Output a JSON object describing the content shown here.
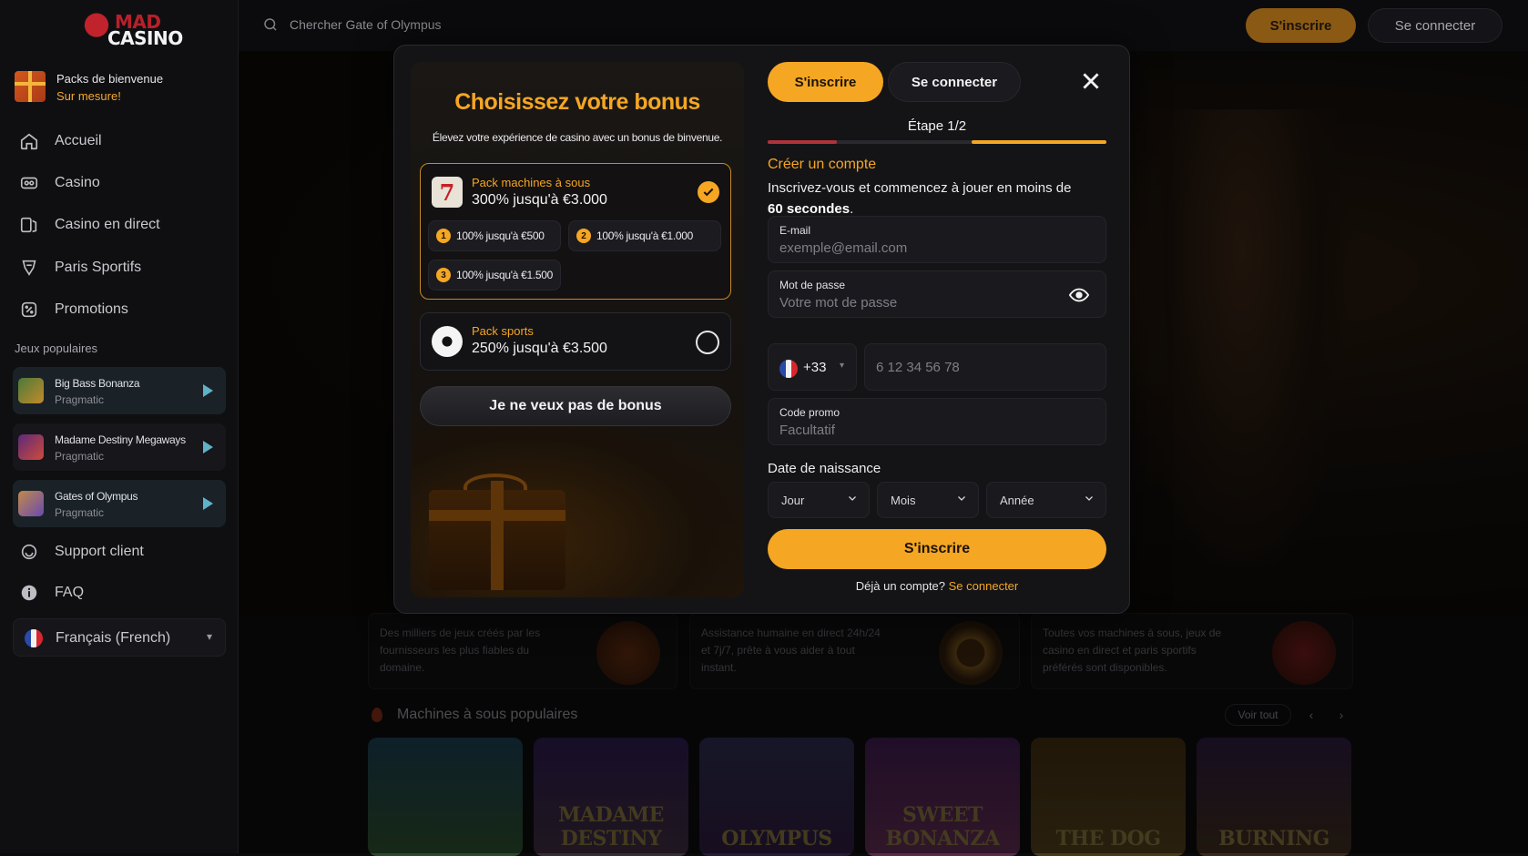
{
  "brand": {
    "mad": "MAD",
    "casino": "CASINO"
  },
  "welcome": {
    "title": "Packs de bienvenue",
    "subtitle": "Sur mesure!"
  },
  "nav": [
    {
      "label": "Accueil",
      "icon": "home-icon"
    },
    {
      "label": "Casino",
      "icon": "casino-icon"
    },
    {
      "label": "Casino en direct",
      "icon": "live-casino-icon"
    },
    {
      "label": "Paris Sportifs",
      "icon": "sports-icon"
    },
    {
      "label": "Promotions",
      "icon": "promotions-icon"
    }
  ],
  "popular_section": "Jeux populaires",
  "popular_games": [
    {
      "name": "Big Bass Bonanza",
      "provider": "Pragmatic"
    },
    {
      "name": "Madame Destiny Megaways",
      "provider": "Pragmatic"
    },
    {
      "name": "Gates of Olympus",
      "provider": "Pragmatic"
    }
  ],
  "support": {
    "support": "Support client",
    "faq": "FAQ"
  },
  "language": "Français (French)",
  "topbar": {
    "search_placeholder": "Chercher Gate of Olympus",
    "register": "S'inscrire",
    "login": "Se connecter"
  },
  "features": [
    "Des milliers de jeux créés par les fournisseurs les plus fiables du domaine.",
    "Assistance humaine en direct 24h/24 et 7j/7, prête à vous aider à tout instant.",
    "Toutes vos machines à sous, jeux de casino en direct et paris sportifs préférés sont disponibles."
  ],
  "popular_slots": {
    "title": "Machines à sous populaires",
    "see_all": "Voir tout",
    "tiles": [
      "",
      "MADAME DESTINY",
      "OLYMPUS",
      "SWEET BONANZA",
      "THE DOG",
      "BURNING"
    ]
  },
  "bonus": {
    "title": "Choisissez votre bonus",
    "subtitle": "Élevez votre expérience de casino avec un bonus de binvenue.",
    "slots_pack": {
      "label": "Pack machines à sous",
      "value": "300% jusqu'à €3.000",
      "tiers": [
        {
          "n": "1",
          "text": "100% jusqu'à €500"
        },
        {
          "n": "2",
          "text": "100% jusqu'à €1.000"
        },
        {
          "n": "3",
          "text": "100% jusqu'à €1.500"
        }
      ]
    },
    "sports_pack": {
      "label": "Pack sports",
      "value": "250% jusqu'à €3.500"
    },
    "no_bonus": "Je ne veux pas de bonus"
  },
  "form": {
    "tab_register": "S'inscrire",
    "tab_login": "Se connecter",
    "step": "Étape 1/2",
    "progress_fraction": 0.5,
    "title": "Créer un compte",
    "intro": "Inscrivez-vous et commencez à jouer en moins de",
    "intro_bold": "60 secondes",
    "email_label": "E-mail",
    "email_placeholder": "exemple@email.com",
    "password_label": "Mot de passe",
    "password_placeholder": "Votre mot de passe",
    "country_code": "+33",
    "phone_placeholder": "6 12 34 56 78",
    "promo_label": "Code promo",
    "promo_placeholder": "Facultatif",
    "dob_label": "Date de naissance",
    "day": "Jour",
    "month": "Mois",
    "year": "Année",
    "submit": "S'inscrire",
    "already": "Déjà un compte?",
    "login_link": "Se connecter"
  },
  "colors": {
    "accent": "#f5a623",
    "background": "#0b0b0d",
    "modal": "#141417"
  }
}
